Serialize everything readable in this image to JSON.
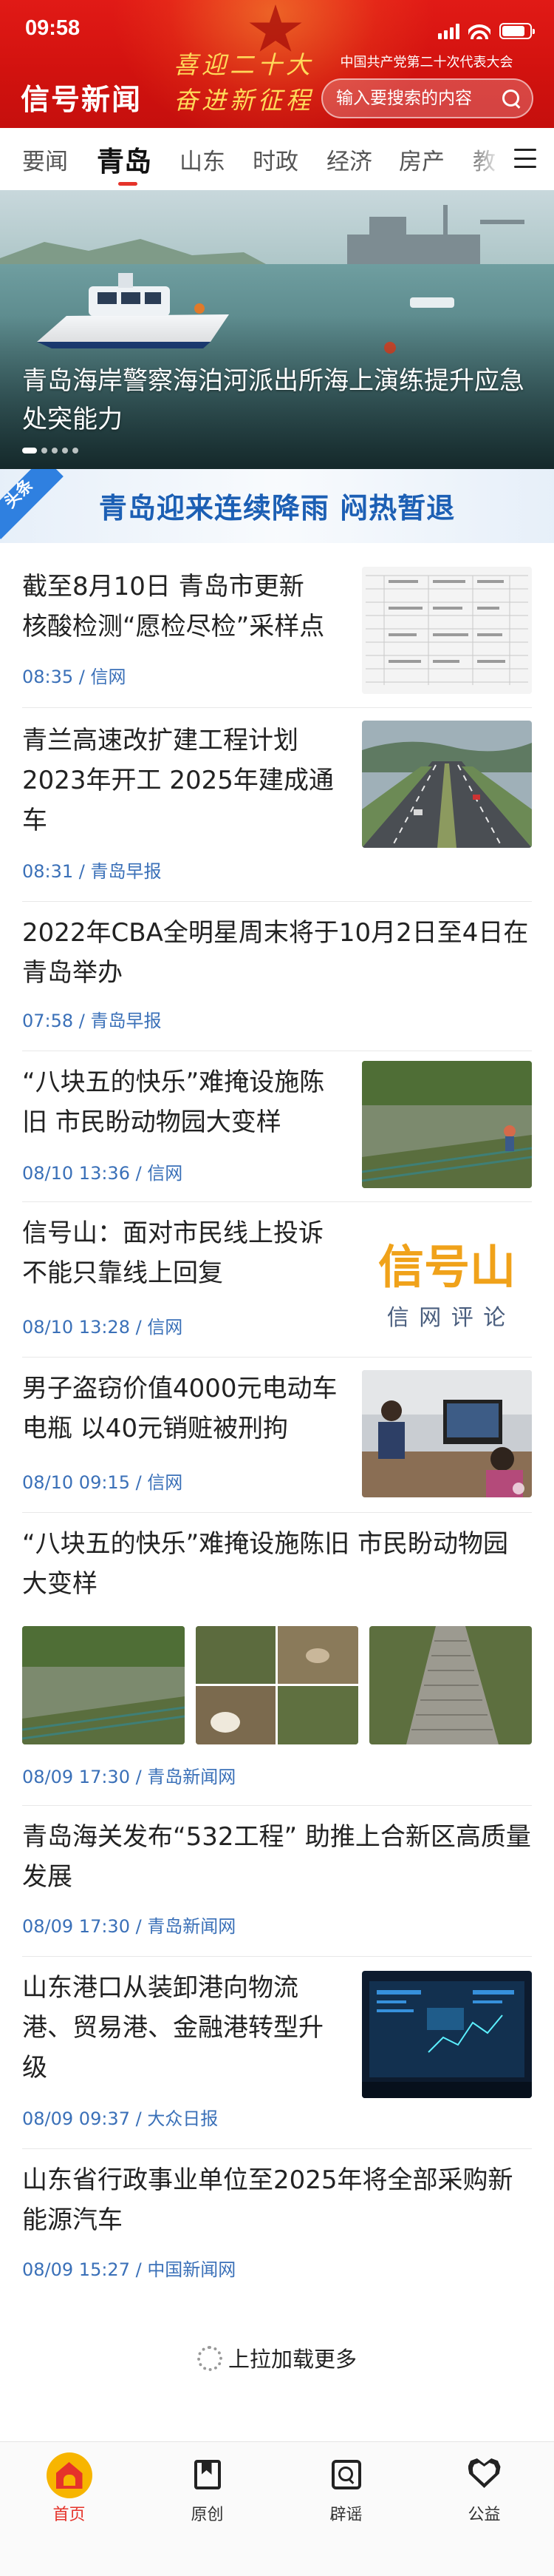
{
  "status_bar": {
    "time": "09:58"
  },
  "header": {
    "logo": "信号新闻",
    "slogan_line1": "喜迎二十大",
    "slogan_line2": "奋进新征程",
    "congress_text": "中国共产党第二十次代表大会",
    "search_placeholder": "输入要搜索的内容",
    "brand_color": "#d2120f"
  },
  "tabs": {
    "items": [
      "要闻",
      "青岛",
      "山东",
      "时政",
      "经济",
      "房产",
      "教"
    ],
    "active": "青岛"
  },
  "hero": {
    "caption": "青岛海岸警察海泊河派出所海上演练提升应急处突能力",
    "slide_count": 5,
    "active_slide": 1
  },
  "headline": {
    "tag": "头条",
    "text": "青岛迎来连续降雨 闷热暂退"
  },
  "feed": [
    {
      "title": "截至8月10日 青岛市更新核酸检测“愿检尽检”采样点",
      "time": "08:35",
      "source": "信网",
      "thumb": "document-table"
    },
    {
      "title": "青兰高速改扩建工程计划2023年开工 2025年建成通车",
      "time": "08:31",
      "source": "青岛早报",
      "thumb": "highway"
    },
    {
      "title": "2022年CBA全明星周末将于10月2日至4日在青岛举办",
      "time": "07:58",
      "source": "青岛早报"
    },
    {
      "title": "“八块五的快乐”难掩设施陈旧 市民盼动物园大变样",
      "time": "08/10 13:36",
      "source": "信网",
      "thumb": "zoo-pond"
    },
    {
      "title": "信号山：面对市民线上投诉不能只靠线上回复",
      "time": "08/10 13:28",
      "source": "信网",
      "thumb": "xinhaoshan-logo",
      "thumb_text_main": "信号山",
      "thumb_text_sub": "信 网 评 论"
    },
    {
      "title": "男子盗窃价值4000元电动车电瓶 以40元销赃被刑拘",
      "time": "08/10 09:15",
      "source": "信网",
      "thumb": "police-office"
    },
    {
      "title": "“八块五的快乐”难掩设施陈旧 市民盼动物园大变样",
      "time": "08/09 17:30",
      "source": "青岛新闻网",
      "thumbs": [
        "zoo-pond",
        "goat-pen",
        "stone-steps"
      ]
    },
    {
      "title": "青岛海关发布“532工程” 助推上合新区高质量发展",
      "time": "08/09 17:30",
      "source": "青岛新闻网"
    },
    {
      "title": "山东港口从装卸港向物流港、贸易港、金融港转型升级",
      "time": "08/09 09:37",
      "source": "大众日报",
      "thumb": "control-screen"
    },
    {
      "title": "山东省行政事业单位至2025年将全部采购新能源汽车",
      "time": "08/09 15:27",
      "source": "中国新闻网"
    }
  ],
  "feed_meta_sep": " / ",
  "load_more": "上拉加载更多",
  "bottom_nav": [
    {
      "label": "首页",
      "icon": "home-icon",
      "active": true
    },
    {
      "label": "原创",
      "icon": "bookmark-icon",
      "active": false
    },
    {
      "label": "辟谣",
      "icon": "search-box-icon",
      "active": false
    },
    {
      "label": "公益",
      "icon": "heart-icon",
      "active": false
    }
  ],
  "accent_color": "#e5332a",
  "meta_color": "#3a70b8"
}
